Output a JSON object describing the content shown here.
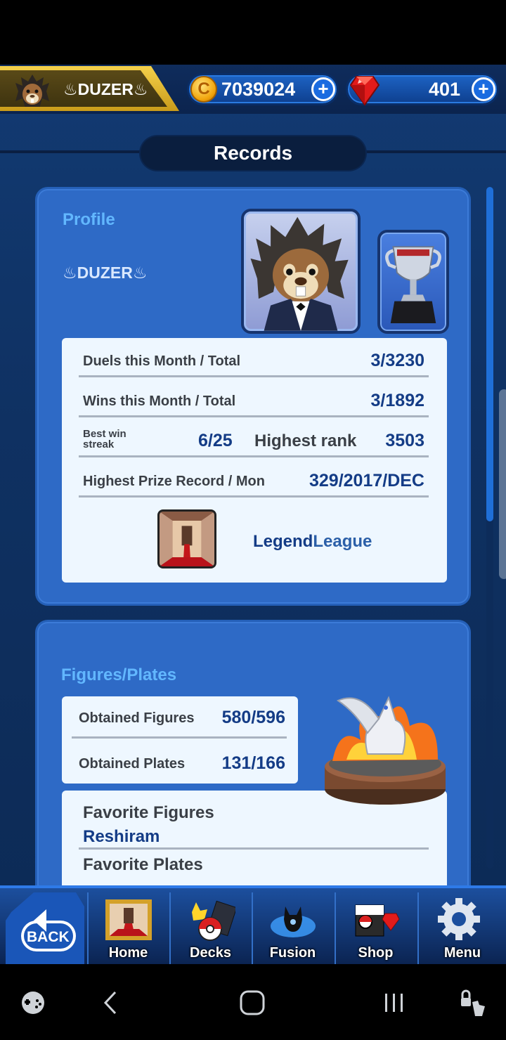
{
  "player": {
    "name": "♨DUZER♨"
  },
  "currency": {
    "coins": "7039024",
    "coin_symbol": "C",
    "gems": "401",
    "plus": "+"
  },
  "page": {
    "title": "Records"
  },
  "profile": {
    "section_label": "Profile",
    "name": "♨DUZER♨",
    "stats": {
      "duels_label": "Duels this Month / Total",
      "duels_value": "3/3230",
      "wins_label": "Wins this Month / Total",
      "wins_value": "3/1892",
      "streak_label": "Best win streak",
      "streak_value": "6/25",
      "rank_label": "Highest rank",
      "rank_value": "3503",
      "prize_label": "Highest Prize Record / Mon",
      "prize_value": "329/2017/DEC"
    },
    "league": {
      "part1": "Legend",
      "part2": "League"
    }
  },
  "figures": {
    "section_label": "Figures/Plates",
    "obtained_figures_label": "Obtained Figures",
    "obtained_figures_value": "580/596",
    "obtained_plates_label": "Obtained Plates",
    "obtained_plates_value": "131/166",
    "favorite_figures_label": "Favorite Figures",
    "favorite_figure": "Reshiram",
    "favorite_plates_label": "Favorite Plates"
  },
  "nav": {
    "back": "BACK",
    "home": "Home",
    "decks": "Decks",
    "fusion": "Fusion",
    "shop": "Shop",
    "menu": "Menu"
  },
  "colors": {
    "card_blue": "#2e6ac6",
    "panel": "#eef7ff",
    "accent_label": "#62b7ff",
    "value_navy": "#143c86",
    "gold": "#f4d14b"
  }
}
